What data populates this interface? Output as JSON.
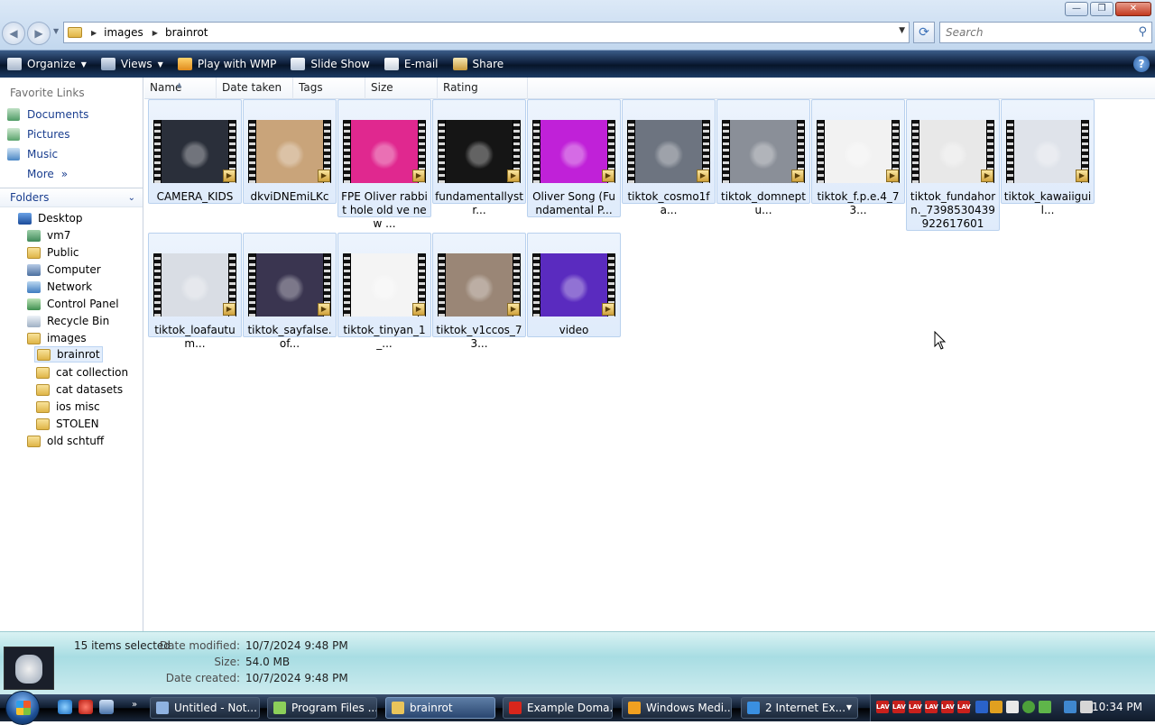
{
  "window": {
    "minimize": "—",
    "maximize": "❐",
    "close": "✕"
  },
  "address": {
    "crumbs": [
      "images",
      "brainrot"
    ],
    "search_placeholder": "Search"
  },
  "toolbar": {
    "organize": "Organize",
    "views": "Views",
    "play": "Play with WMP",
    "slideshow": "Slide Show",
    "email": "E-mail",
    "share": "Share",
    "help": "?"
  },
  "leftpane": {
    "favorites_title": "Favorite Links",
    "favorites": [
      "Documents",
      "Pictures",
      "Music",
      "More"
    ],
    "more_chevron": "»",
    "folders_title": "Folders",
    "tree": [
      "Desktop",
      "vm7",
      "Public",
      "Computer",
      "Network",
      "Control Panel",
      "Recycle Bin",
      "images",
      "brainrot",
      "cat collection",
      "cat datasets",
      "ios misc",
      "STOLEN",
      "old schtuff"
    ]
  },
  "columns": [
    "Name",
    "Date taken",
    "Tags",
    "Size",
    "Rating"
  ],
  "files": [
    {
      "name": "CAMERA_KIDS",
      "color": "#2a2f3a"
    },
    {
      "name": "dkviDNEmiLKc",
      "color": "#c9a47a"
    },
    {
      "name": "FPE Oliver rabbit hole old ve new ...",
      "color": "#e0288f"
    },
    {
      "name": "fundamentallystr...",
      "color": "#151515"
    },
    {
      "name": "Oliver Song (Fundamental P...",
      "color": "#c021d8"
    },
    {
      "name": "tiktok_cosmo1fa...",
      "color": "#6d7480"
    },
    {
      "name": "tiktok_domneptu...",
      "color": "#8a8f98"
    },
    {
      "name": "tiktok_f.p.e.4_73...",
      "color": "#f2f2f2"
    },
    {
      "name": "tiktok_fundahorn._7398530439922617601",
      "color": "#e8e8e8"
    },
    {
      "name": "tiktok_kawaiiguil...",
      "color": "#dfe3ea"
    },
    {
      "name": "tiktok_loafautum...",
      "color": "#d9dde4"
    },
    {
      "name": "tiktok_sayfalse.of...",
      "color": "#3a3550"
    },
    {
      "name": "tiktok_tinyan_1_...",
      "color": "#f4f4f4"
    },
    {
      "name": "tiktok_v1ccos_73...",
      "color": "#9a8676"
    },
    {
      "name": "video",
      "color": "#5a2bbf"
    }
  ],
  "details": {
    "count": "15 items selected",
    "date_modified_label": "Date modified:",
    "date_modified": "10/7/2024 9:48 PM",
    "size_label": "Size:",
    "size": "54.0 MB",
    "date_created_label": "Date created:",
    "date_created": "10/7/2024 9:48 PM"
  },
  "taskbar": {
    "quicklaunch_more": "»",
    "tasks": [
      {
        "label": "Untitled - Not...",
        "icon_color": "#8fb2e0"
      },
      {
        "label": "Program Files ...",
        "icon_color": "#8ccf5a"
      },
      {
        "label": "brainrot",
        "icon_color": "#e9c45a"
      },
      {
        "label": "Example Doma...",
        "icon_color": "#d8261c"
      },
      {
        "label": "Windows Medi...",
        "icon_color": "#f0a020"
      },
      {
        "label": "2 Internet Ex...",
        "icon_color": "#3a8fe0"
      }
    ],
    "clock": "10:34 PM"
  }
}
